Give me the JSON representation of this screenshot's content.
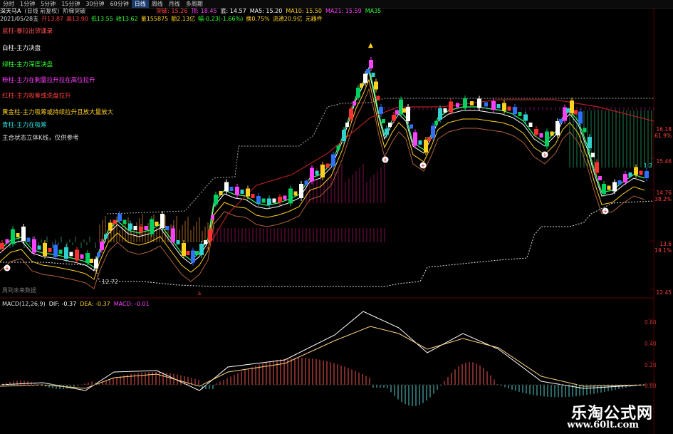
{
  "toolbar": {
    "items": [
      "分时",
      "1分钟",
      "5分钟",
      "15分钟",
      "30分钟",
      "60分钟",
      "日线",
      "周线",
      "月线",
      "多周期"
    ],
    "active_index": 6
  },
  "header": {
    "stock": "深天马A",
    "mode": "(日线 前复权)",
    "indicator_name": "阶梯突破",
    "tupo": "突破: 15.26",
    "ding": "顶: 18.45",
    "di": "底: 14.57",
    "ma5": "MA5: 15.20",
    "ma10": "MA10: 15.50",
    "ma21": "MA21: 15.59",
    "ma35": "MA35"
  },
  "quote": {
    "date": "2021/05/28五",
    "open": "开13.87",
    "high": "高13.90",
    "low": "低13.55",
    "close": "收13.62",
    "vol": "量155875",
    "amount": "额2.13亿",
    "change": "幅-0.23(-1.66%)",
    "turnover": "换0.75%",
    "float": "流通20.9亿",
    "tool": "元器件"
  },
  "legend": {
    "l1": "蓝柱-暴拉出货谨录",
    "l2": "白柱-主力决盘",
    "l3": "绿柱-主力深度决盘",
    "l4": "粉柱-主力在剩量拉升拉在高位拉升",
    "l5": "红柱-主力吸筹或洗盘拉升",
    "l6": "黄金柱-主力吸筹或持续拉升且放大量放大",
    "l7": "青柱-主力在吸筹",
    "l8": "主合状态立体K线，仅供参考"
  },
  "price_axis": {
    "v1": "16.18",
    "v2": "61.9%",
    "v3": "15.46",
    "v4": "14.76",
    "v5": "38.2%",
    "v6": "13.6",
    "v7": "19.1%",
    "v8": "12.45"
  },
  "annotations": {
    "low_label": "12.72",
    "future": "周到未来数据",
    "right_label": "1.2"
  },
  "macd": {
    "name": "MACD(12,26,9)",
    "dif": "DIF: -0.37",
    "dea": "DEA: -0.37",
    "macd": "MACD: -0.01",
    "ticks": [
      "0.60",
      "0.40",
      "0.20",
      "0.00"
    ]
  },
  "watermark": {
    "cn": "乐淘公式网",
    "url": "www.60lt.com"
  },
  "colors": {
    "up": "#ff3030",
    "down": "#00d060",
    "blue": "#3070ff",
    "pink": "#ff40ff",
    "gold": "#ffd020",
    "white": "#ffffff",
    "cyan": "#30d0d0"
  }
}
